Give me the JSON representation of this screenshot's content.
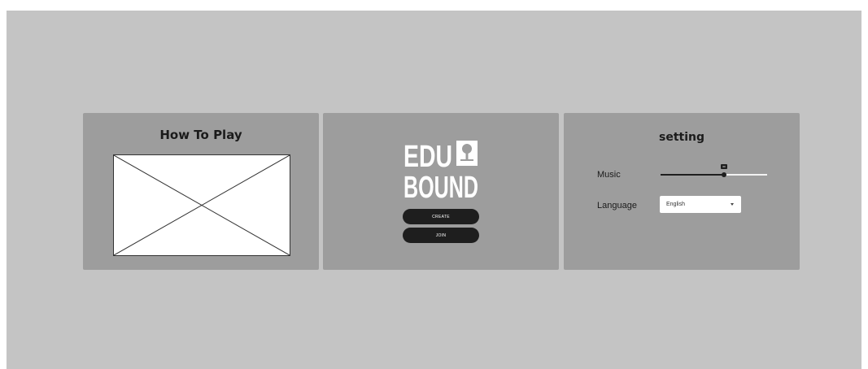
{
  "how_to_play": {
    "title": "How To Play"
  },
  "menu": {
    "logo_top": "EDU",
    "logo_bottom": "BOUND",
    "create_label": "CREATE",
    "join_label": "JOIN"
  },
  "setting": {
    "title": "setting",
    "music_label": "Music",
    "music_value": 60,
    "language_label": "Language",
    "language_value": "English"
  },
  "colors": {
    "canvas": "#c4c4c4",
    "panel": "#9d9d9d",
    "button": "#1e1e1e"
  }
}
